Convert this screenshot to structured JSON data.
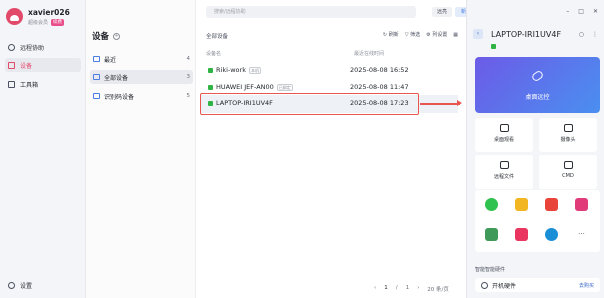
{
  "profile": {
    "username": "xavier026",
    "member_label": "超级会员",
    "badge": "续费"
  },
  "nav": {
    "items": [
      {
        "label": "远程协助",
        "icon": "connect-icon"
      },
      {
        "label": "设备",
        "icon": "device-icon"
      },
      {
        "label": "工具箱",
        "icon": "toolbox-icon"
      }
    ],
    "settings_label": "设置"
  },
  "groups": {
    "title": "设备",
    "items": [
      {
        "label": "最近",
        "count": "4"
      },
      {
        "label": "全部设备",
        "count": "3"
      },
      {
        "label": "识别码设备",
        "count": "5"
      }
    ]
  },
  "main": {
    "search_placeholder": "搜索/远程协助",
    "toggle_list": "远亮",
    "toggle_cloud": "新版",
    "header": "全部设备",
    "tools": [
      "刷新",
      "筛选",
      "列设置"
    ],
    "col_name": "设备名",
    "col_time": "最近在线时间",
    "rows": [
      {
        "name": "Riki-work",
        "tag": "本机",
        "time": "2025-08-08 16:52"
      },
      {
        "name": "HUAWEI JEF-AN00",
        "tag": "已绑定",
        "time": "2025-08-08 11:47"
      },
      {
        "name": "LAPTOP-IRI1UV4F",
        "tag": "",
        "time": "2025-08-08 17:23"
      }
    ],
    "pager": {
      "page": "1",
      "sep": "/",
      "total": "1",
      "page_size": "20 条/页"
    }
  },
  "right": {
    "title": "LAPTOP-IRI1UV4F",
    "remote_label": "桌面远控",
    "tiles": [
      "桌面观看",
      "摄像头",
      "远程文件",
      "CMD"
    ],
    "apps": [
      "wechat-icon",
      "folder-icon",
      "wps-icon",
      "pen-icon",
      "box-icon",
      "bookmark-icon",
      "edge-icon",
      "more-icon"
    ],
    "section": "智能智能硬件",
    "hardware_label": "开机硬件",
    "hardware_buy": "去购买"
  },
  "colors": {
    "accent": "#e2496b",
    "online": "#2fb344",
    "highlight": "#e8574f"
  }
}
